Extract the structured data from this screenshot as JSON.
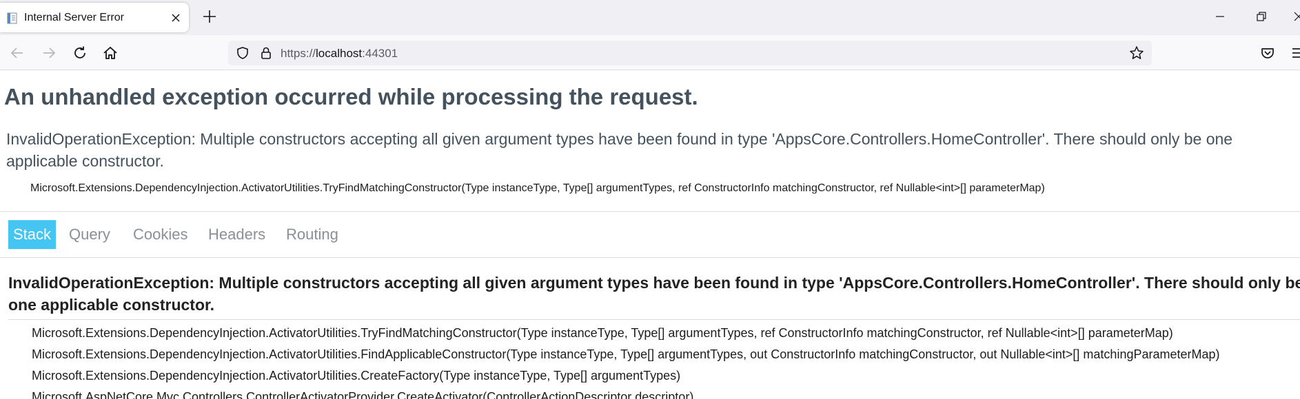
{
  "browser": {
    "tab_title": "Internal Server Error",
    "url_scheme": "https://",
    "url_host": "localhost",
    "url_port": ":44301"
  },
  "page": {
    "heading": "An unhandled exception occurred while processing the request.",
    "error_message": "InvalidOperationException: Multiple constructors accepting all given argument types have been found in type 'AppsCore.Controllers.HomeController'. There should only be one applicable constructor.",
    "error_location": "Microsoft.Extensions.DependencyInjection.ActivatorUtilities.TryFindMatchingConstructor(Type instanceType, Type[] argumentTypes, ref ConstructorInfo matchingConstructor, ref Nullable<int>[] parameterMap)",
    "tabs": [
      {
        "label": "Stack",
        "active": true
      },
      {
        "label": "Query",
        "active": false
      },
      {
        "label": "Cookies",
        "active": false
      },
      {
        "label": "Headers",
        "active": false
      },
      {
        "label": "Routing",
        "active": false
      }
    ],
    "stack_heading": "InvalidOperationException: Multiple constructors accepting all given argument types have been found in type 'AppsCore.Controllers.HomeController'. There should only be one applicable constructor.",
    "frames": [
      "Microsoft.Extensions.DependencyInjection.ActivatorUtilities.TryFindMatchingConstructor(Type instanceType, Type[] argumentTypes, ref ConstructorInfo matchingConstructor, ref Nullable<int>[] parameterMap)",
      "Microsoft.Extensions.DependencyInjection.ActivatorUtilities.FindApplicableConstructor(Type instanceType, Type[] argumentTypes, out ConstructorInfo matchingConstructor, out Nullable<int>[] matchingParameterMap)",
      "Microsoft.Extensions.DependencyInjection.ActivatorUtilities.CreateFactory(Type instanceType, Type[] argumentTypes)",
      "Microsoft.AspNetCore.Mvc.Controllers.ControllerActivatorProvider.CreateActivator(ControllerActionDescriptor descriptor)"
    ]
  },
  "colors": {
    "heading": "#44525e",
    "active_tab": "#44c5f2",
    "inactive_tab": "#8a9099"
  },
  "icons": {
    "tab_favicon": "document-icon",
    "tab_close": "close-icon",
    "new_tab": "plus-icon",
    "minimize": "minimize-icon",
    "restore": "restore-icon",
    "close_window": "close-window-icon",
    "back": "back-arrow-icon",
    "forward": "forward-arrow-icon",
    "reload": "reload-icon",
    "home": "home-icon",
    "tracking": "shield-icon",
    "lock": "lock-icon",
    "bookmark": "star-icon",
    "pocket": "pocket-icon",
    "menu": "hamburger-menu-icon"
  }
}
